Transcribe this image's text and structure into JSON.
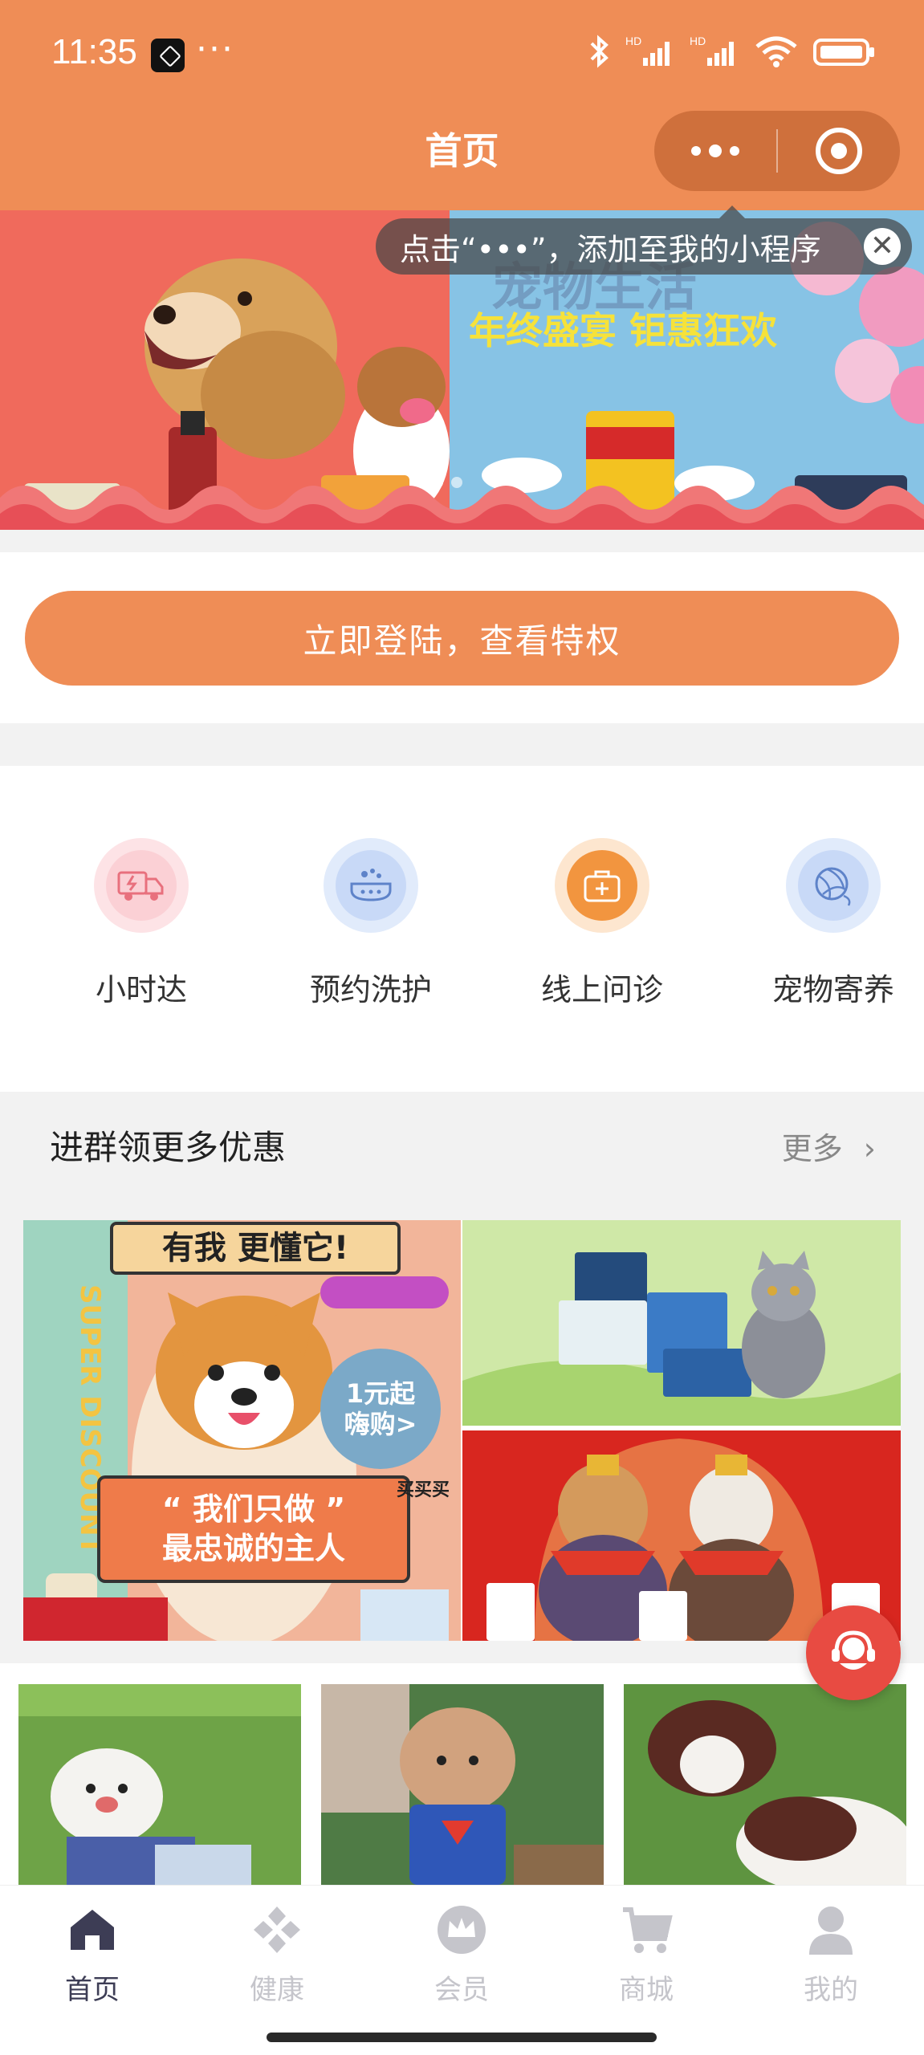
{
  "status_bar": {
    "time": "11:35",
    "more": "···"
  },
  "nav": {
    "title": "首页"
  },
  "tip": {
    "text": "点击“•••”，添加至我的小程序",
    "close": "✕"
  },
  "banner": {
    "title": "宠物生活",
    "subtitle": "年终盛宴 钜惠狂欢"
  },
  "login": {
    "label": "立即登陆，查看特权"
  },
  "services": [
    {
      "label": "小时达",
      "icon": "truck-icon",
      "color": "#f19aa4"
    },
    {
      "label": "预约洗护",
      "icon": "bath-icon",
      "color": "#8fb3ee"
    },
    {
      "label": "线上问诊",
      "icon": "medkit-icon",
      "color": "#f2953f"
    },
    {
      "label": "宠物寄养",
      "icon": "yarn-ball-icon",
      "color": "#8fb3ee"
    }
  ],
  "group": {
    "title": "进群领更多优惠",
    "more": "更多"
  },
  "promo": {
    "headline": "有我 更懂它!",
    "side": "SUPER DISCOUNT",
    "bubble_1": "1元起",
    "bubble_2": "嗨购>",
    "quote_1": "“ 我们只做 ”",
    "quote_2": "最忠诚的主人",
    "tag": "买买买"
  },
  "tabs": [
    {
      "label": "首页",
      "icon": "home-icon"
    },
    {
      "label": "健康",
      "icon": "health-icon"
    },
    {
      "label": "会员",
      "icon": "crown-icon"
    },
    {
      "label": "商城",
      "icon": "cart-icon"
    },
    {
      "label": "我的",
      "icon": "user-icon"
    }
  ]
}
